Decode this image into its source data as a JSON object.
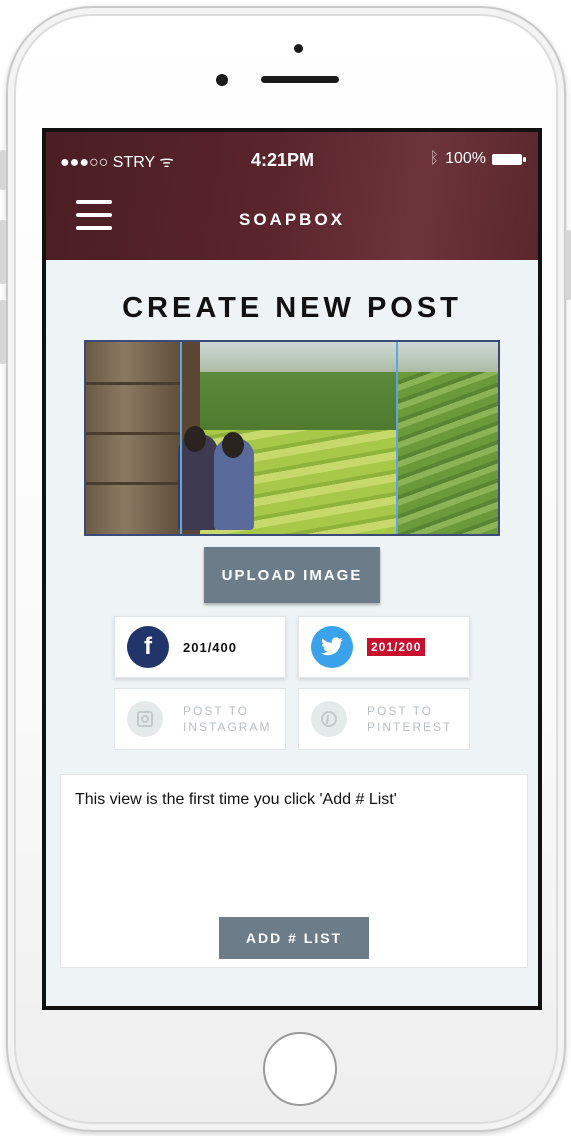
{
  "status_bar": {
    "carrier": "●●●○○ STRY ᯤ",
    "time": "4:21PM",
    "battery": "100%"
  },
  "header": {
    "title": "SOAPBOX",
    "menu_icon": "hamburger-menu-icon"
  },
  "page_title": "CREATE NEW POST",
  "upload_button": "UPLOAD IMAGE",
  "social": {
    "facebook": {
      "icon": "f",
      "count": "201/400"
    },
    "twitter": {
      "icon": "twitter-bird",
      "count": "201/200"
    },
    "instagram": {
      "line1": "POST TO",
      "line2": "INSTAGRAM"
    },
    "pinterest": {
      "line1": "POST TO",
      "line2": "PINTEREST"
    }
  },
  "post_text": "This view is the first time you click 'Add # List'",
  "add_list_button": "ADD # LIST",
  "colors": {
    "header": "#5a242c",
    "button": "#6d7c89",
    "facebook": "#22356b",
    "twitter": "#3aa2ea",
    "over_limit": "#c8102e"
  }
}
